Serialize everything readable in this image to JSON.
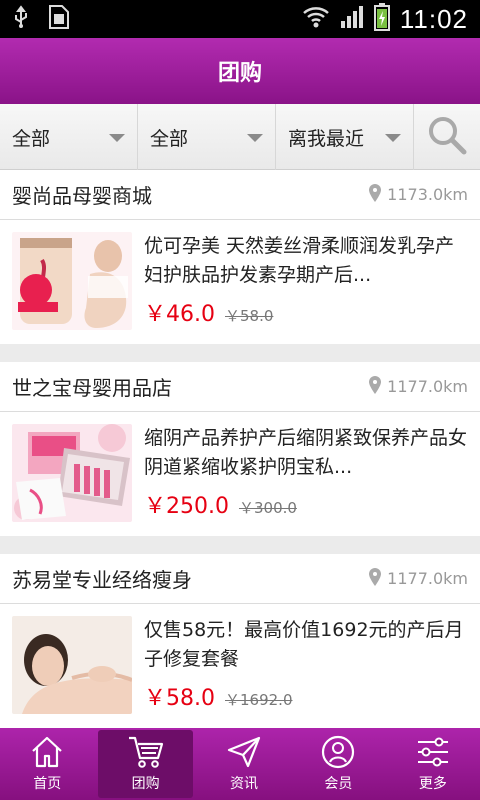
{
  "status": {
    "time": "11:02"
  },
  "header": {
    "title": "团购"
  },
  "filters": [
    {
      "label": "全部"
    },
    {
      "label": "全部"
    },
    {
      "label": "离我最近"
    }
  ],
  "shops": [
    {
      "name": "婴尚品母婴商城",
      "distance": "1173.0km",
      "item": {
        "title": "优可孕美 天然姜丝滑柔顺润发乳孕产妇护肤品护发素孕期产后...",
        "price": "￥46.0",
        "old_price": "￥58.0"
      }
    },
    {
      "name": "世之宝母婴用品店",
      "distance": "1177.0km",
      "item": {
        "title": "缩阴产品养护产后缩阴紧致保养产品女阴道紧缩收紧护阴宝私...",
        "price": "￥250.0",
        "old_price": "￥300.0"
      }
    },
    {
      "name": "苏易堂专业经络瘦身",
      "distance": "1177.0km",
      "item": {
        "title": "仅售58元！最高价值1692元的产后月子修复套餐",
        "price": "￥58.0",
        "old_price": "￥1692.0"
      }
    }
  ],
  "tabs": [
    {
      "label": "首页",
      "icon": "home-icon"
    },
    {
      "label": "团购",
      "icon": "cart-icon"
    },
    {
      "label": "资讯",
      "icon": "send-icon"
    },
    {
      "label": "会员",
      "icon": "member-icon"
    },
    {
      "label": "更多",
      "icon": "settings-sliders-icon"
    }
  ],
  "colors": {
    "accent": "#a21ea0",
    "price": "#e60012"
  }
}
